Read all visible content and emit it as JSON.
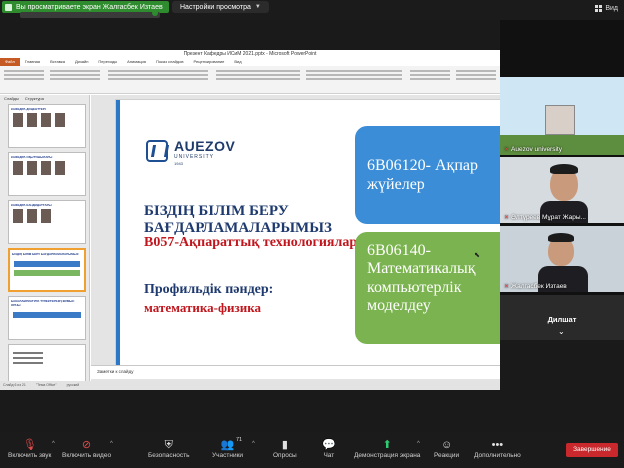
{
  "zoom_top": {
    "share_notice": "Вы просматриваете экран Жалгасбек Изтаев",
    "view_options": "Настройки просмотра",
    "view_button": "Вид"
  },
  "ppt": {
    "window_title": "Презент Кафедры ИСиМ 2021.pptx - Microsoft PowerPoint",
    "tabs": [
      "Файл",
      "Главная",
      "Вставка",
      "Дизайн",
      "Переходы",
      "Анимация",
      "Показ слайдов",
      "Рецензирование",
      "Вид"
    ],
    "panel_tabs": [
      "Слайды",
      "Структура"
    ],
    "thumbnails": [
      {
        "num": "1",
        "title": "КАФЕДРА ДОЦЕНТТЕРІ"
      },
      {
        "num": "2",
        "title": "КАФЕДРА ОҚЫТУШЫЛАРЫ"
      },
      {
        "num": "3",
        "title": "КАФЕДРА КАНДИДАТТАРЫ"
      },
      {
        "num": "4",
        "title": "БІЗДІҢ БІЛІМ БЕРУ БАҒДАРЛАМАЛАРЫМЫЗ"
      },
      {
        "num": "5",
        "title": "БАКАЛАВРИАТУРА ТҮЛЕКТЕРІНІҢ ЖҰМЫС ОРНЫ"
      },
      {
        "num": "6",
        "title": ""
      }
    ],
    "slide": {
      "logo_name": "AUEZOV",
      "logo_sub": "UNIVERSITY",
      "logo_year": "1943",
      "heading": "БІЗДІҢ БІЛІМ БЕРУ БАҒДАРЛАМАЛАРЫМЫЗ",
      "program_code": "B057-Ақпараттық технологиялар",
      "profile_label": "Профильдік пәндер:",
      "profile_value": "математика-физика",
      "box1": "6В06120- Ақпар жүйелер",
      "box2": "6В06140- Математикалық компьютерлік моделдеу"
    },
    "notes": "Заметки к слайду",
    "status": [
      "Слайд 6 из 21",
      "\"Тема Office\"",
      "русский"
    ]
  },
  "participants": [
    {
      "name": "Auezov university",
      "muted": true
    },
    {
      "name": "Әлтүреев Мұрат Жары...",
      "muted": true
    },
    {
      "name": "Жалгасбек Изтаев",
      "muted": true
    },
    {
      "name": "Дилшат",
      "muted": false
    }
  ],
  "toolbar": {
    "items": [
      {
        "label": "Включить звук"
      },
      {
        "label": "Включить видео"
      },
      {
        "label": "Безопасность"
      },
      {
        "label": "Участники",
        "count": "71"
      },
      {
        "label": "Опросы"
      },
      {
        "label": "Чат"
      },
      {
        "label": "Демонстрация экрана"
      },
      {
        "label": "Реакции"
      },
      {
        "label": "Дополнительно"
      }
    ],
    "end_label": "Завершение"
  },
  "colors": {
    "accent_green": "#2e8b2e",
    "box_blue": "#3a8dd6",
    "box_green": "#7ab34f",
    "heading_navy": "#1f3a6e",
    "heading_red": "#c0161d",
    "end_red": "#c9292c"
  }
}
